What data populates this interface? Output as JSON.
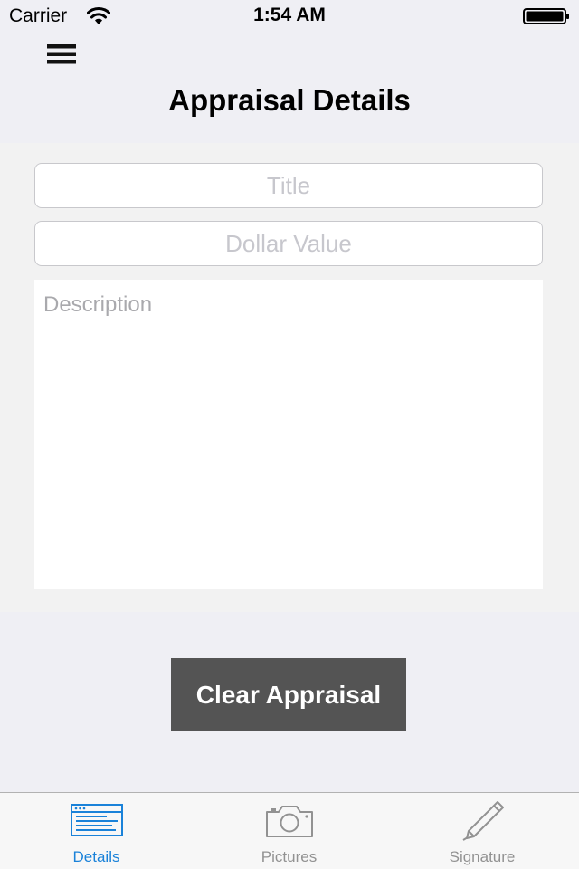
{
  "status_bar": {
    "carrier": "Carrier",
    "time": "1:54 AM"
  },
  "header": {
    "title": "Appraisal Details",
    "menu_icon": "hamburger-menu-icon"
  },
  "form": {
    "title_placeholder": "Title",
    "title_value": "",
    "dollar_placeholder": "Dollar Value",
    "dollar_value": "",
    "description_placeholder": "Description",
    "description_value": ""
  },
  "actions": {
    "clear_label": "Clear Appraisal"
  },
  "tab_bar": {
    "tabs": [
      {
        "label": "Details",
        "icon": "document-window-icon",
        "active": true
      },
      {
        "label": "Pictures",
        "icon": "camera-icon",
        "active": false
      },
      {
        "label": "Signature",
        "icon": "pen-icon",
        "active": false
      }
    ]
  },
  "colors": {
    "accent": "#1a82d9",
    "button_bg": "#545454",
    "background": "#efeff4",
    "inactive_tab": "#929292"
  }
}
